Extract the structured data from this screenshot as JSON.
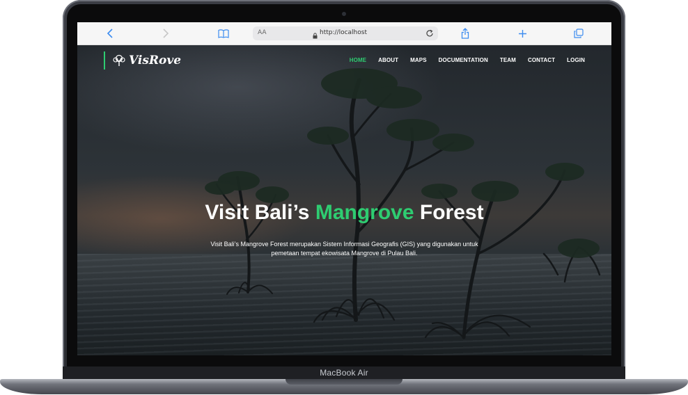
{
  "device": {
    "model_label": "MacBook Air"
  },
  "browser": {
    "text_size_label": "AA",
    "url": "http://localhost",
    "icons": {
      "back": "chevron-left-icon",
      "forward": "chevron-right-icon",
      "bookmarks": "book-icon",
      "reload": "reload-icon",
      "share": "share-icon",
      "new_tab": "plus-icon",
      "tabs": "tabs-icon",
      "lock": "lock-icon"
    }
  },
  "site": {
    "logo_part1": "Vis",
    "logo_part2": "Rove",
    "nav": [
      {
        "label": "HOME",
        "active": true
      },
      {
        "label": "ABOUT",
        "active": false
      },
      {
        "label": "MAPS",
        "active": false
      },
      {
        "label": "DOCUMENTATION",
        "active": false
      },
      {
        "label": "TEAM",
        "active": false
      },
      {
        "label": "CONTACT",
        "active": false
      },
      {
        "label": "LOGIN",
        "active": false
      }
    ],
    "hero": {
      "title_part1": "Visit Bali’s ",
      "title_highlight": "Mangrove",
      "title_part2": " Forest",
      "description": "Visit Bali’s Mangrove Forest merupakan Sistem Informasi Geografis (GIS) yang digunakan untuk pemetaan tempat ekowisata Mangrove di Pulau Bali.",
      "slides": 2,
      "active_slide": 2
    }
  },
  "colors": {
    "accent": "#2ecc71",
    "safari_blue": "#3c8cf0"
  }
}
